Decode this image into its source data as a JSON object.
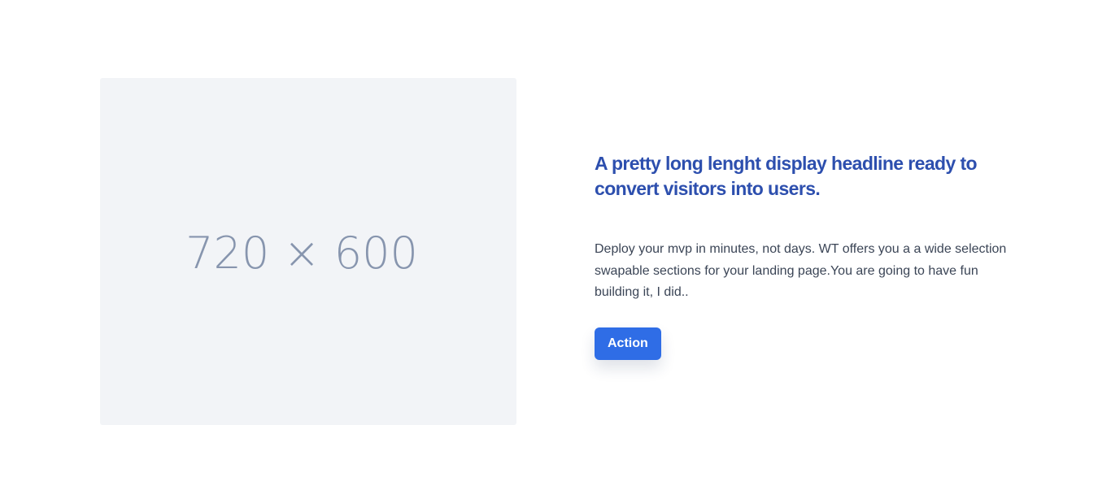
{
  "hero": {
    "image_placeholder_label": "720 × 600",
    "headline": "A pretty long lenght display headline ready to convert visitors into users.",
    "body": "Deploy your mvp in minutes, not days. WT offers you a a wide selection swapable sections for your landing page.You are going to have fun building it, I did..",
    "action_label": "Action"
  },
  "colors": {
    "headline": "#2d4fae",
    "button_bg": "#2f6de6",
    "placeholder_bg": "#f2f4f7",
    "placeholder_text": "#8795ae",
    "body_text": "#3b4556"
  }
}
